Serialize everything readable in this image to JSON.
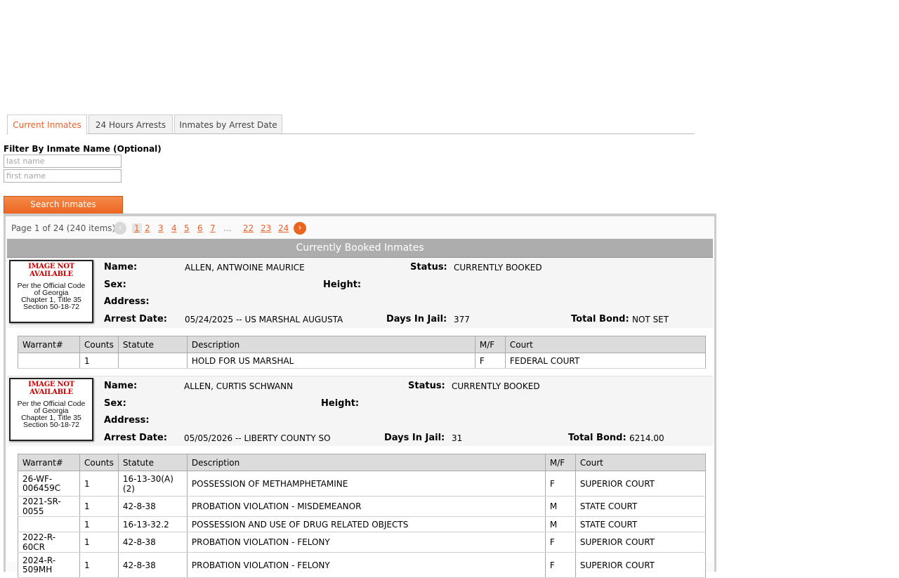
{
  "tabs": [
    "Current Inmates",
    "24 Hours Arrests",
    "Inmates by Arrest Date"
  ],
  "filter": {
    "label": "Filter By Inmate Name (Optional)",
    "last_placeholder": "last name",
    "first_placeholder": "first name",
    "button": "Search Inmates"
  },
  "pager": {
    "info": "Page 1 of 24 (240 items)",
    "prev": "‹",
    "next": "›",
    "pages": [
      "1",
      "2",
      "3",
      "4",
      "5",
      "6",
      "7"
    ],
    "dots": "...",
    "tail": [
      "22",
      "23",
      "24"
    ]
  },
  "grid_title": "Currently Booked Inmates",
  "photo": {
    "not_available": "IMAGE NOT AVAILABLE",
    "code_lines": [
      "Per the Official Code",
      "of Georgia",
      "Chapter 1, Title 35",
      "Section 50-18-72"
    ]
  },
  "labels": {
    "name": "Name:",
    "status": "Status:",
    "sex": "Sex:",
    "height": "Height:",
    "address": "Address:",
    "arrest_date": "Arrest Date:",
    "days": "Days In Jail:",
    "bond": "Total Bond:"
  },
  "columns": [
    "Warrant#",
    "Counts",
    "Statute",
    "Description",
    "M/F",
    "Court"
  ],
  "inmates": [
    {
      "name": "ALLEN, ANTWOINE MAURICE",
      "status": "CURRENTLY BOOKED",
      "sex": "",
      "height": "",
      "address": "",
      "arrest_date": "05/24/2025 -- US MARSHAL AUGUSTA",
      "days": "377",
      "bond": "NOT SET",
      "charges": [
        {
          "warrant": "",
          "counts": "1",
          "statute": "",
          "description": "HOLD FOR US MARSHAL",
          "mf": "F",
          "court": "FEDERAL COURT"
        }
      ]
    },
    {
      "name": "ALLEN, CURTIS SCHWANN",
      "status": "CURRENTLY BOOKED",
      "sex": "",
      "height": "",
      "address": "",
      "arrest_date": "05/05/2026 -- LIBERTY COUNTY SO",
      "days": "31",
      "bond": "6214.00",
      "charges": [
        {
          "warrant": "26-WF-006459C",
          "counts": "1",
          "statute": "16-13-30(A)(2)",
          "description": "POSSESSION OF METHAMPHETAMINE",
          "mf": "F",
          "court": "SUPERIOR COURT"
        },
        {
          "warrant": "2021-SR-0055",
          "counts": "1",
          "statute": "42-8-38",
          "description": "PROBATION VIOLATION - MISDEMEANOR",
          "mf": "M",
          "court": "STATE COURT"
        },
        {
          "warrant": "",
          "counts": "1",
          "statute": "16-13-32.2",
          "description": "POSSESSION AND USE OF DRUG RELATED OBJECTS",
          "mf": "M",
          "court": "STATE COURT"
        },
        {
          "warrant": "2022-R-60CR",
          "counts": "1",
          "statute": "42-8-38",
          "description": "PROBATION VIOLATION - FELONY",
          "mf": "F",
          "court": "SUPERIOR COURT"
        },
        {
          "warrant": "2024-R-509MH",
          "counts": "1",
          "statute": "42-8-38",
          "description": "PROBATION VIOLATION - FELONY",
          "mf": "F",
          "court": "SUPERIOR COURT"
        }
      ]
    }
  ]
}
